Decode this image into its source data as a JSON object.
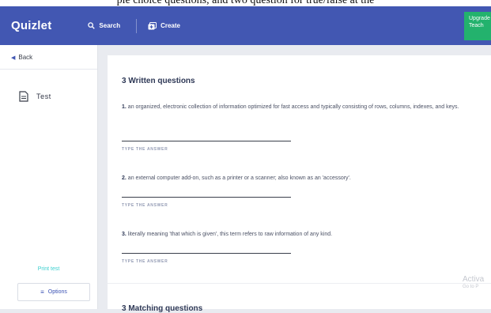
{
  "caption": "ple choice questions, and two question for true/false at the",
  "header": {
    "logo": "Quizlet",
    "search_label": "Search",
    "create_label": "Create",
    "upgrade_line1": "Upgrade",
    "upgrade_line2": "Teach"
  },
  "sidebar": {
    "back_label": "Back",
    "doc_label": "Test",
    "print_label": "Print test",
    "options_label": "Options"
  },
  "main": {
    "written_title": "3 Written questions",
    "questions": [
      {
        "num": "1.",
        "text": "an organized, electronic collection of information optimized for fast access and typically consisting of rows, columns, indexes, and keys."
      },
      {
        "num": "2.",
        "text": "an external computer add-on, such as a printer or a scanner; also known as an 'accessory'."
      },
      {
        "num": "3.",
        "text": "literally meaning 'that which is given', this term refers to raw information of any kind."
      }
    ],
    "answer_label": "TYPE THE ANSWER",
    "matching_title": "3 Matching questions"
  },
  "watermark": {
    "line1": "Activa",
    "line2": "Go to P"
  },
  "colors": {
    "brand": "#4257b2",
    "upgrade": "#23b26d",
    "print_link": "#3ccfcf"
  }
}
